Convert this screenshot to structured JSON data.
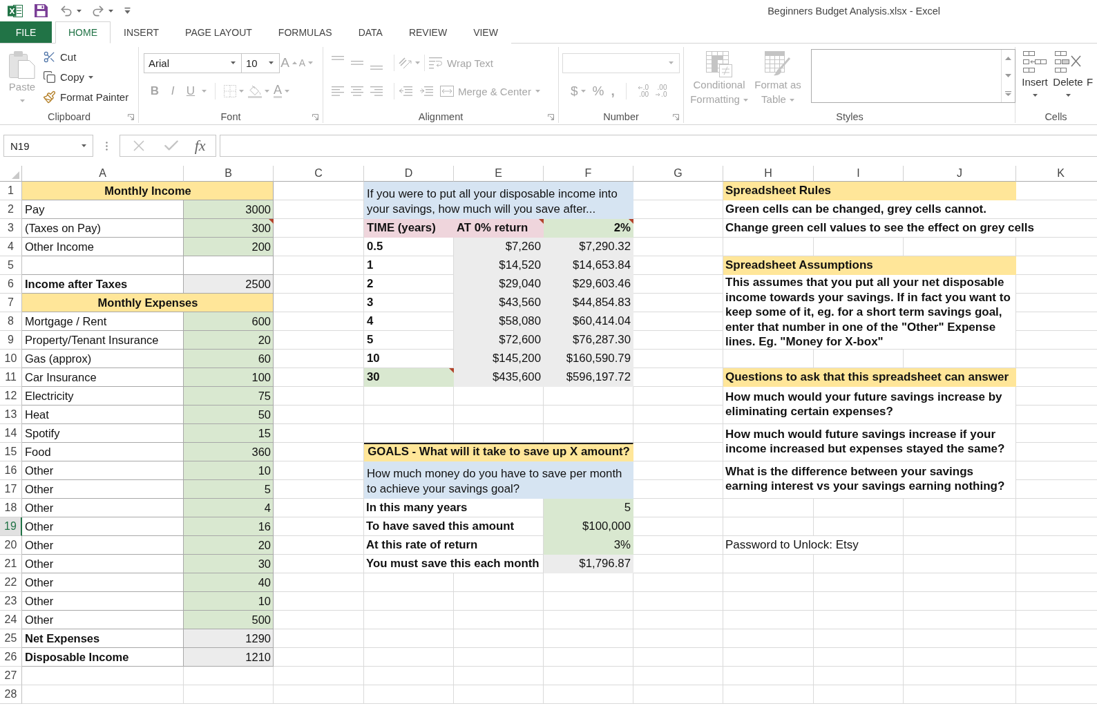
{
  "window": {
    "title": "Beginners Budget Analysis.xlsx - Excel"
  },
  "ribbon_tabs": [
    {
      "label": "FILE",
      "kind": "backstage",
      "selected": false
    },
    {
      "label": "HOME",
      "kind": "tab",
      "selected": true
    },
    {
      "label": "INSERT",
      "kind": "tab",
      "selected": false
    },
    {
      "label": "PAGE LAYOUT",
      "kind": "tab",
      "selected": false
    },
    {
      "label": "FORMULAS",
      "kind": "tab",
      "selected": false
    },
    {
      "label": "DATA",
      "kind": "tab",
      "selected": false
    },
    {
      "label": "REVIEW",
      "kind": "tab",
      "selected": false
    },
    {
      "label": "VIEW",
      "kind": "tab",
      "selected": false
    }
  ],
  "ribbon": {
    "clipboard": {
      "label": "Clipboard",
      "paste": {
        "label": "Paste",
        "disabled": true
      },
      "cut": {
        "label": "Cut",
        "disabled": false
      },
      "copy": {
        "label": "Copy",
        "disabled": false
      },
      "format_painter": {
        "label": "Format Painter",
        "disabled": false
      }
    },
    "font": {
      "label": "Font",
      "disabled": true,
      "font_name": "Arial",
      "font_size": "10",
      "grow": "A",
      "shrink": "A",
      "styles": [
        {
          "kind": "bold",
          "label": "B"
        },
        {
          "kind": "italic",
          "label": "I"
        },
        {
          "kind": "underline",
          "label": "U"
        }
      ],
      "font_color": "A"
    },
    "alignment": {
      "label": "Alignment",
      "disabled": true,
      "wrap_text": "Wrap Text",
      "merge_center": "Merge & Center"
    },
    "number": {
      "label": "Number",
      "disabled": true,
      "currency": "$",
      "percent": "%",
      "comma": ",",
      "decimals": [
        {
          "kind": "increase",
          "top": ".0",
          "bottom": ".00"
        },
        {
          "kind": "decrease",
          "top": ".00",
          "bottom": ".0"
        }
      ]
    },
    "styles": {
      "label": "Styles",
      "disabled": true,
      "conditional_formatting": "Conditional Formatting",
      "format_as_table": "Format as Table"
    },
    "cells": {
      "label": "Cells",
      "buttons": [
        {
          "kind": "insert",
          "label": "Insert",
          "disabled": false
        },
        {
          "kind": "delete",
          "label": "Delete",
          "disabled": false
        },
        {
          "kind": "format",
          "label": "F",
          "disabled": false
        }
      ]
    }
  },
  "formula_bar": {
    "name_box": "N19",
    "function_button": "fx"
  },
  "sheet": {
    "column_headers": [
      "A",
      "B",
      "C",
      "D",
      "E",
      "F",
      "G",
      "H",
      "I",
      "J",
      "K"
    ],
    "row_headers": [
      {
        "label": "1",
        "selected": false
      },
      {
        "label": "2",
        "selected": false
      },
      {
        "label": "3",
        "selected": false
      },
      {
        "label": "4",
        "selected": false
      },
      {
        "label": "5",
        "selected": false
      },
      {
        "label": "6",
        "selected": false
      },
      {
        "label": "7",
        "selected": false
      },
      {
        "label": "8",
        "selected": false
      },
      {
        "label": "9",
        "selected": false
      },
      {
        "label": "10",
        "selected": false
      },
      {
        "label": "11",
        "selected": false
      },
      {
        "label": "12",
        "selected": false
      },
      {
        "label": "13",
        "selected": false
      },
      {
        "label": "14",
        "selected": false
      },
      {
        "label": "15",
        "selected": false
      },
      {
        "label": "16",
        "selected": false
      },
      {
        "label": "17",
        "selected": false
      },
      {
        "label": "18",
        "selected": false
      },
      {
        "label": "19",
        "selected": true
      },
      {
        "label": "20",
        "selected": false
      },
      {
        "label": "21",
        "selected": false
      },
      {
        "label": "22",
        "selected": false
      },
      {
        "label": "23",
        "selected": false
      },
      {
        "label": "24",
        "selected": false
      },
      {
        "label": "25",
        "selected": false
      },
      {
        "label": "26",
        "selected": false
      },
      {
        "label": "27",
        "selected": false
      },
      {
        "label": "28",
        "selected": false
      }
    ],
    "budget": [
      {
        "kind": "heading",
        "label": "Monthly Income",
        "comment": false
      },
      {
        "kind": "input",
        "label": "Pay",
        "value": "3000",
        "comment": false
      },
      {
        "kind": "input",
        "label": "(Taxes on Pay)",
        "value": "300",
        "comment": true
      },
      {
        "kind": "input",
        "label": "Other Income",
        "value": "200",
        "comment": false
      },
      {
        "kind": "blank",
        "comment": false
      },
      {
        "kind": "total",
        "label": "Income after Taxes",
        "value": "2500",
        "comment": false
      },
      {
        "kind": "heading",
        "label": "Monthly Expenses",
        "comment": false
      },
      {
        "kind": "input",
        "label": "Mortgage / Rent",
        "value": "600",
        "comment": false
      },
      {
        "kind": "input",
        "label": "Property/Tenant Insurance",
        "value": "20",
        "comment": false
      },
      {
        "kind": "input",
        "label": "Gas (approx)",
        "value": "60",
        "comment": false
      },
      {
        "kind": "input",
        "label": "Car Insurance",
        "value": "100",
        "comment": false
      },
      {
        "kind": "input",
        "label": "Electricity",
        "value": "75",
        "comment": false
      },
      {
        "kind": "input",
        "label": "Heat",
        "value": "50",
        "comment": false
      },
      {
        "kind": "input",
        "label": "Spotify",
        "value": "15",
        "comment": false
      },
      {
        "kind": "input",
        "label": "Food",
        "value": "360",
        "comment": false
      },
      {
        "kind": "input",
        "label": "Other",
        "value": "10",
        "comment": false
      },
      {
        "kind": "input",
        "label": "Other",
        "value": "5",
        "comment": false
      },
      {
        "kind": "input",
        "label": "Other",
        "value": "4",
        "comment": false
      },
      {
        "kind": "input",
        "label": "Other",
        "value": "16",
        "comment": false
      },
      {
        "kind": "input",
        "label": "Other",
        "value": "20",
        "comment": false
      },
      {
        "kind": "input",
        "label": "Other",
        "value": "30",
        "comment": false
      },
      {
        "kind": "input",
        "label": "Other",
        "value": "40",
        "comment": false
      },
      {
        "kind": "input",
        "label": "Other",
        "value": "10",
        "comment": false
      },
      {
        "kind": "input",
        "label": "Other",
        "value": "500",
        "comment": false
      },
      {
        "kind": "total",
        "label": "Net Expenses",
        "value": "1290",
        "comment": false
      },
      {
        "kind": "total",
        "label": "Disposable Income",
        "value": "1210",
        "comment": false
      }
    ],
    "projection": {
      "intro": "If you were to put all your disposable income into your savings, how much will you save after...",
      "columns": [
        {
          "kind": "label",
          "label": "TIME (years)",
          "comment": false
        },
        {
          "kind": "label",
          "label": "AT 0% return",
          "comment": true
        },
        {
          "kind": "input",
          "label": "2%",
          "comment": true
        }
      ],
      "rows": [
        {
          "kind": "fixed",
          "years": "0.5",
          "no_return": "$7,260",
          "with_return": "$7,290.32",
          "comment": false
        },
        {
          "kind": "fixed",
          "years": "1",
          "no_return": "$14,520",
          "with_return": "$14,653.84",
          "comment": false
        },
        {
          "kind": "fixed",
          "years": "2",
          "no_return": "$29,040",
          "with_return": "$29,603.46",
          "comment": false
        },
        {
          "kind": "fixed",
          "years": "3",
          "no_return": "$43,560",
          "with_return": "$44,854.83",
          "comment": false
        },
        {
          "kind": "fixed",
          "years": "4",
          "no_return": "$58,080",
          "with_return": "$60,414.04",
          "comment": false
        },
        {
          "kind": "fixed",
          "years": "5",
          "no_return": "$72,600",
          "with_return": "$76,287.30",
          "comment": false
        },
        {
          "kind": "fixed",
          "years": "10",
          "no_return": "$145,200",
          "with_return": "$160,590.79",
          "comment": false
        },
        {
          "kind": "input",
          "years": "30",
          "no_return": "$435,600",
          "with_return": "$596,197.72",
          "comment": true
        }
      ]
    },
    "goals": {
      "title": "GOALS - What will it take to save up X amount?",
      "question": "How much money do you have to save per month to achieve your savings goal?",
      "rows": [
        {
          "kind": "input",
          "label": "In this many years",
          "value": "5"
        },
        {
          "kind": "input",
          "label": "To have saved this amount",
          "value": "$100,000"
        },
        {
          "kind": "input",
          "label": "At this rate of return",
          "value": "3%"
        },
        {
          "kind": "output",
          "label": "You must save this each month",
          "value": "$1,796.87"
        }
      ]
    },
    "notes": {
      "rules_title": "Spreadsheet Rules",
      "rules": [
        "Green cells can be changed, grey cells cannot.",
        "Change green cell values to see the effect on grey cells"
      ],
      "assumptions_title": "Spreadsheet Assumptions",
      "assumptions": "This assumes that you put all your net disposable income towards your savings. If in fact you want to keep some of it, eg. for a short term savings goal, enter that number in one of the \"Other\" Expense lines. Eg. \"Money for X-box\"",
      "questions_title": "Questions to ask that this spreadsheet can answer",
      "questions": [
        "How much would your future savings increase by eliminating certain expenses?",
        "How much would future savings increase if your income increased but expenses stayed the same?",
        "What is the difference between your savings earning interest vs your savings earning nothing?"
      ],
      "password": "Password to Unlock: Etsy"
    }
  }
}
